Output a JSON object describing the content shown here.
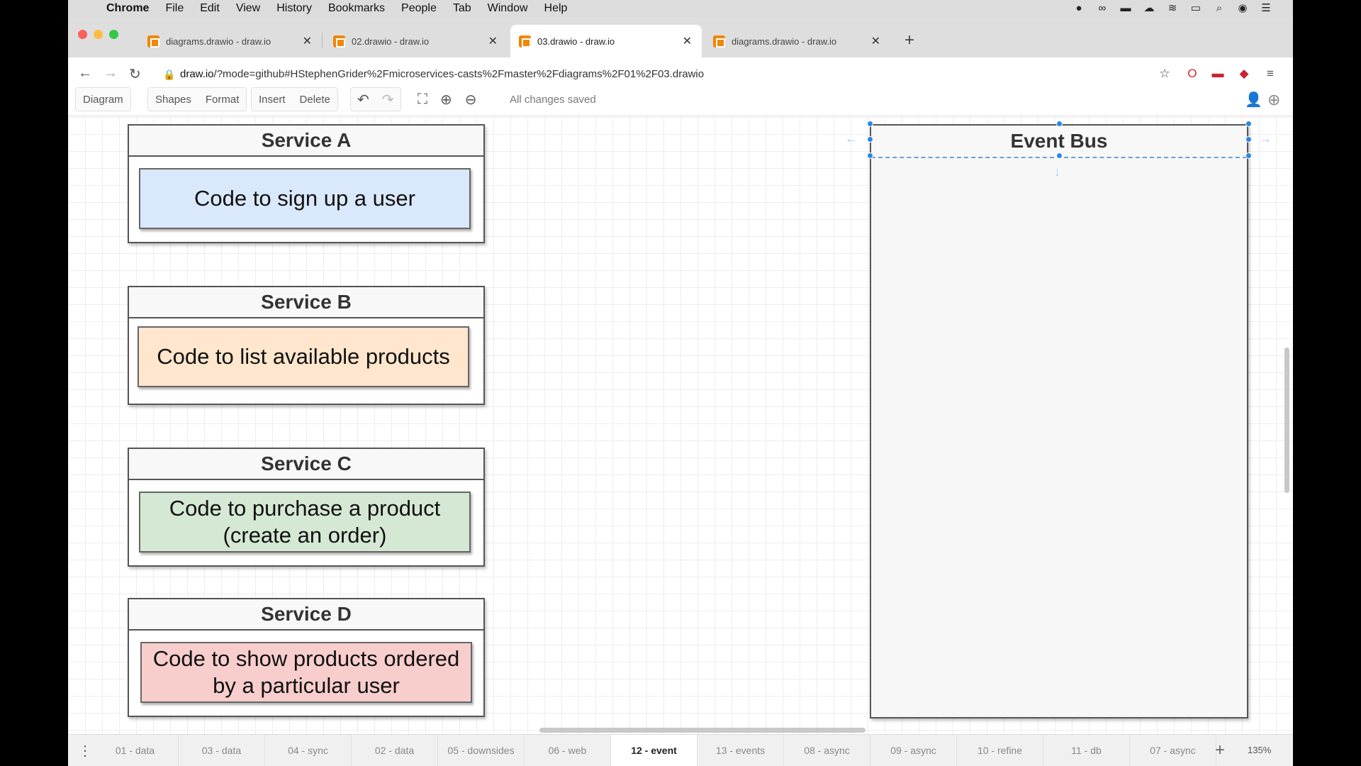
{
  "menubar": {
    "items": [
      "Chrome",
      "File",
      "Edit",
      "View",
      "History",
      "Bookmarks",
      "People",
      "Tab",
      "Window",
      "Help"
    ]
  },
  "tabs": [
    {
      "title": "diagrams.drawio - draw.io"
    },
    {
      "title": "02.drawio - draw.io"
    },
    {
      "title": "03.drawio - draw.io"
    },
    {
      "title": "diagrams.drawio - draw.io"
    }
  ],
  "address": {
    "host": "draw.io",
    "path": "/?mode=github#HStephenGrider%2Fmicroservices-casts%2Fmaster%2Fdiagrams%2F01%2F03.drawio"
  },
  "toolbar": {
    "diagram": "Diagram",
    "shapes": "Shapes",
    "format": "Format",
    "insert": "Insert",
    "delete": "Delete",
    "status": "All changes saved"
  },
  "services": [
    {
      "title": "Service A",
      "code_line1": "Code to sign up a user",
      "code_line2": "",
      "color": "#dae8fc"
    },
    {
      "title": "Service B",
      "code_line1": "Code to list available products",
      "code_line2": "",
      "color": "#ffe6cc"
    },
    {
      "title": "Service C",
      "code_line1": "Code to purchase a product",
      "code_line2": "(create an order)",
      "color": "#d5e8d4"
    },
    {
      "title": "Service D",
      "code_line1": "Code to show products ordered",
      "code_line2": "by a particular user",
      "color": "#f8cecc"
    }
  ],
  "event_bus": {
    "title": "Event Bus"
  },
  "pages": [
    "01 - data",
    "03 - data",
    "04 - sync",
    "02 - data",
    "05 - downsides",
    "06 - web",
    "12 - event",
    "13 - events",
    "08 - async",
    "09 - async",
    "10 - refine",
    "11 - db",
    "07 - async"
  ],
  "active_page": "12 - event",
  "zoom": "135%"
}
